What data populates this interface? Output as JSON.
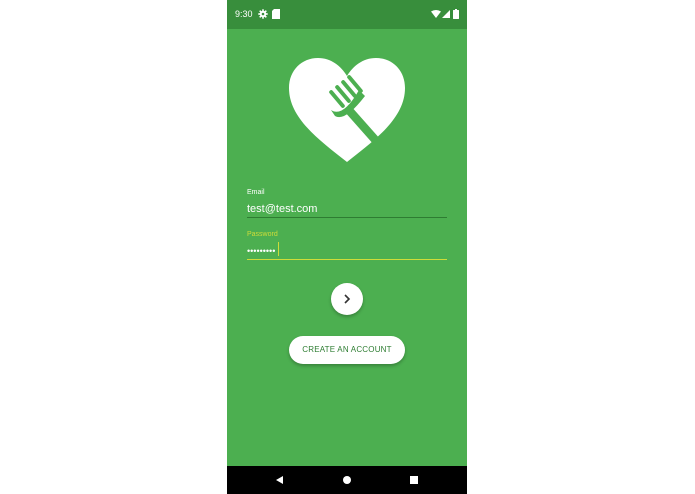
{
  "status_bar": {
    "time": "9:30",
    "icons": [
      "gear-icon",
      "sd-card-icon",
      "wifi-icon",
      "signal-icon",
      "battery-icon"
    ]
  },
  "logo": {
    "icon": "heart-fork-icon"
  },
  "login": {
    "email_label": "Email",
    "email_value": "test@test.com",
    "password_label": "Password",
    "password_value": "•••••••••"
  },
  "actions": {
    "next_icon": "chevron-right-icon",
    "create_account_label": "CREATE AN ACCOUNT"
  },
  "nav_bar": {
    "icons": [
      "back-icon",
      "home-icon",
      "recents-icon"
    ]
  },
  "colors": {
    "background": "#4caf50",
    "status_bar": "#388e3c",
    "accent": "#cddc39",
    "button_text": "#2e7d32"
  }
}
